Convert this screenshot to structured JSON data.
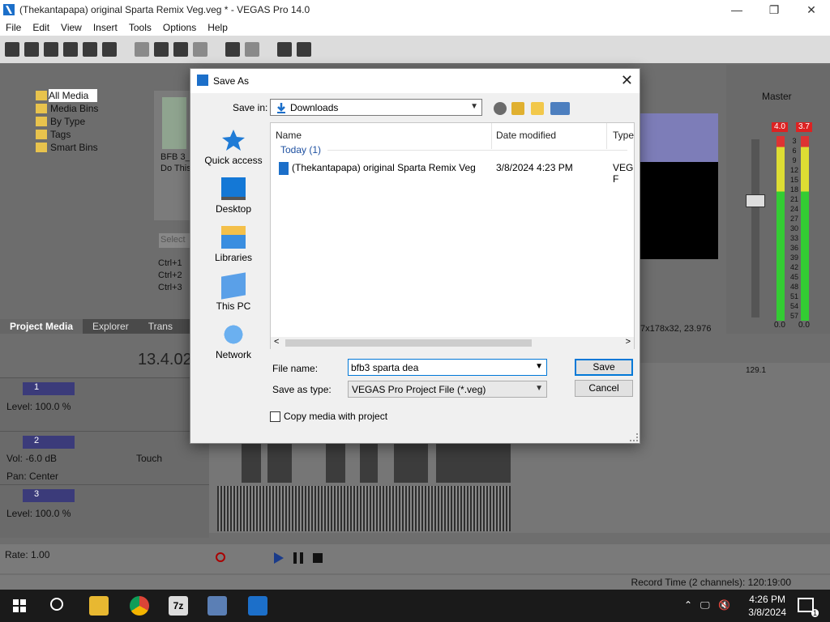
{
  "app": {
    "title": "(Thekantapapa) original Sparta Remix Veg.veg * - VEGAS Pro 14.0",
    "menu": [
      "File",
      "Edit",
      "View",
      "Insert",
      "Tools",
      "Options",
      "Help"
    ],
    "tree": [
      "All Media",
      "Media Bins",
      "By Type",
      "Tags",
      "Smart Bins"
    ],
    "tabs": [
      "Project Media",
      "Explorer",
      "Trans"
    ],
    "timecode": "13.4.02",
    "media_thumb_text": [
      "BFB 3_",
      "Do This"
    ],
    "shortcuts": [
      "Ctrl+1",
      "Ctrl+2",
      "Ctrl+3"
    ],
    "select_placeholder": "Select",
    "tracks": [
      {
        "num": "1",
        "line1": "Level: 100.0 %",
        "line2": ""
      },
      {
        "num": "2",
        "line1": "Vol:      -6.0 dB",
        "line2": "Pan:      Center",
        "mode": "Touch"
      },
      {
        "num": "3",
        "line1": "Level: 100.0 %",
        "line2": ""
      }
    ],
    "ruler_mark": "129.1",
    "rate": "Rate: 1.00",
    "record_time": "Record Time (2 channels): 120:19:00",
    "preview_info": "7x178x32, 23.976",
    "master": {
      "label": "Master",
      "peak_left": "4.0",
      "peak_right": "3.7",
      "bottom_left": "0.0",
      "bottom_right": "0.0"
    },
    "meter_scale": [
      "3",
      "6",
      "9",
      "12",
      "15",
      "18",
      "21",
      "24",
      "27",
      "30",
      "33",
      "36",
      "39",
      "42",
      "45",
      "48",
      "51",
      "54",
      "57"
    ]
  },
  "dialog": {
    "title": "Save As",
    "save_in_label": "Save in:",
    "save_in_value": "Downloads",
    "places": [
      "Quick access",
      "Desktop",
      "Libraries",
      "This PC",
      "Network"
    ],
    "columns": [
      "Name",
      "Date modified",
      "Type"
    ],
    "group": "Today (1)",
    "files": [
      {
        "name": "(Thekantapapa) original Sparta Remix Veg",
        "date": "3/8/2024 4:23 PM",
        "type": "VEG F"
      }
    ],
    "file_name_label": "File name:",
    "file_name_value": "bfb3 sparta dea",
    "save_type_label": "Save as type:",
    "save_type_value": "VEGAS Pro Project File (*.veg)",
    "save_button": "Save",
    "cancel_button": "Cancel",
    "copy_media_label": "Copy media with project"
  },
  "taskbar": {
    "time": "4:26 PM",
    "date": "3/8/2024",
    "notif_count": "1"
  },
  "colors": {
    "accent": "#0078d7",
    "vegas_blue": "#1c6fc9"
  }
}
